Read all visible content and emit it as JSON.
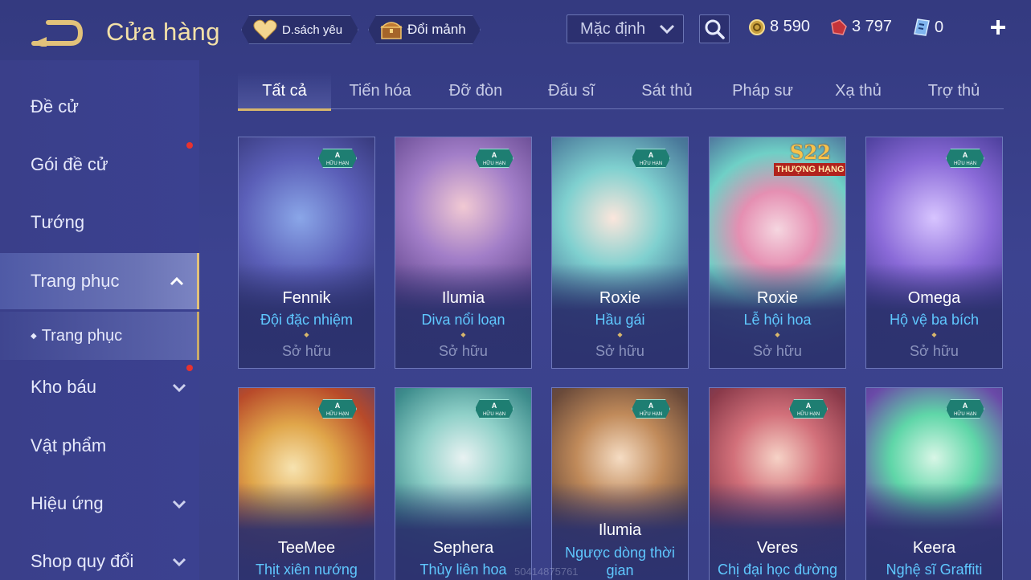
{
  "header": {
    "title": "Cửa hàng",
    "favorites_label": "D.sách yêu",
    "fragment_label": "Đổi mảnh",
    "sort_value": "Mặc định",
    "currencies": [
      {
        "icon": "gold-coin-icon",
        "value": "8 590"
      },
      {
        "icon": "voucher-gem-icon",
        "value": "3 797"
      },
      {
        "icon": "quan-huy-icon",
        "value": "0"
      }
    ]
  },
  "sidebar": {
    "items": [
      {
        "label": "Đề cử"
      },
      {
        "label": "Gói đề cử"
      },
      {
        "label": "Tướng"
      },
      {
        "label": "Trang phục"
      },
      {
        "label": "Trang phục"
      },
      {
        "label": "Kho báu"
      },
      {
        "label": "Vật phẩm"
      },
      {
        "label": "Hiệu ứng"
      },
      {
        "label": "Shop quy đổi"
      }
    ]
  },
  "tabs": [
    {
      "label": "Tất cả"
    },
    {
      "label": "Tiến hóa"
    },
    {
      "label": "Đỡ đòn"
    },
    {
      "label": "Đấu sĩ"
    },
    {
      "label": "Sát thủ"
    },
    {
      "label": "Pháp sư"
    },
    {
      "label": "Xạ thủ"
    },
    {
      "label": "Trợ thủ"
    }
  ],
  "badge": {
    "grade": "A",
    "text": "HỮU HẠN"
  },
  "season_badge": {
    "title": "S22",
    "text": "THƯỢNG HẠNG"
  },
  "cards": [
    {
      "hero": "Fennik",
      "skin": "Đội đặc nhiệm",
      "status": "Sở hữu"
    },
    {
      "hero": "Ilumia",
      "skin": "Diva nổi loạn",
      "status": "Sở hữu"
    },
    {
      "hero": "Roxie",
      "skin": "Hầu gái",
      "status": "Sở hữu"
    },
    {
      "hero": "Roxie",
      "skin": "Lễ hội hoa",
      "status": "Sở hữu"
    },
    {
      "hero": "Omega",
      "skin": "Hộ vệ ba bích",
      "status": "Sở hữu"
    },
    {
      "hero": "TeeMee",
      "skin": "Thịt xiên nướng"
    },
    {
      "hero": "Sephera",
      "skin": "Thủy liên hoa"
    },
    {
      "hero": "Ilumia",
      "skin": "Ngược dòng thời gian"
    },
    {
      "hero": "Veres",
      "skin": "Chị đại học đường"
    },
    {
      "hero": "Keera",
      "skin": "Nghệ sĩ Graffiti"
    }
  ],
  "watermark": "50414875761",
  "colors": {
    "accent_gold": "#d8b76c",
    "skin_blue": "#5fc8ff",
    "badge_teal": "#1e7e72",
    "notify_red": "#e8322f"
  }
}
